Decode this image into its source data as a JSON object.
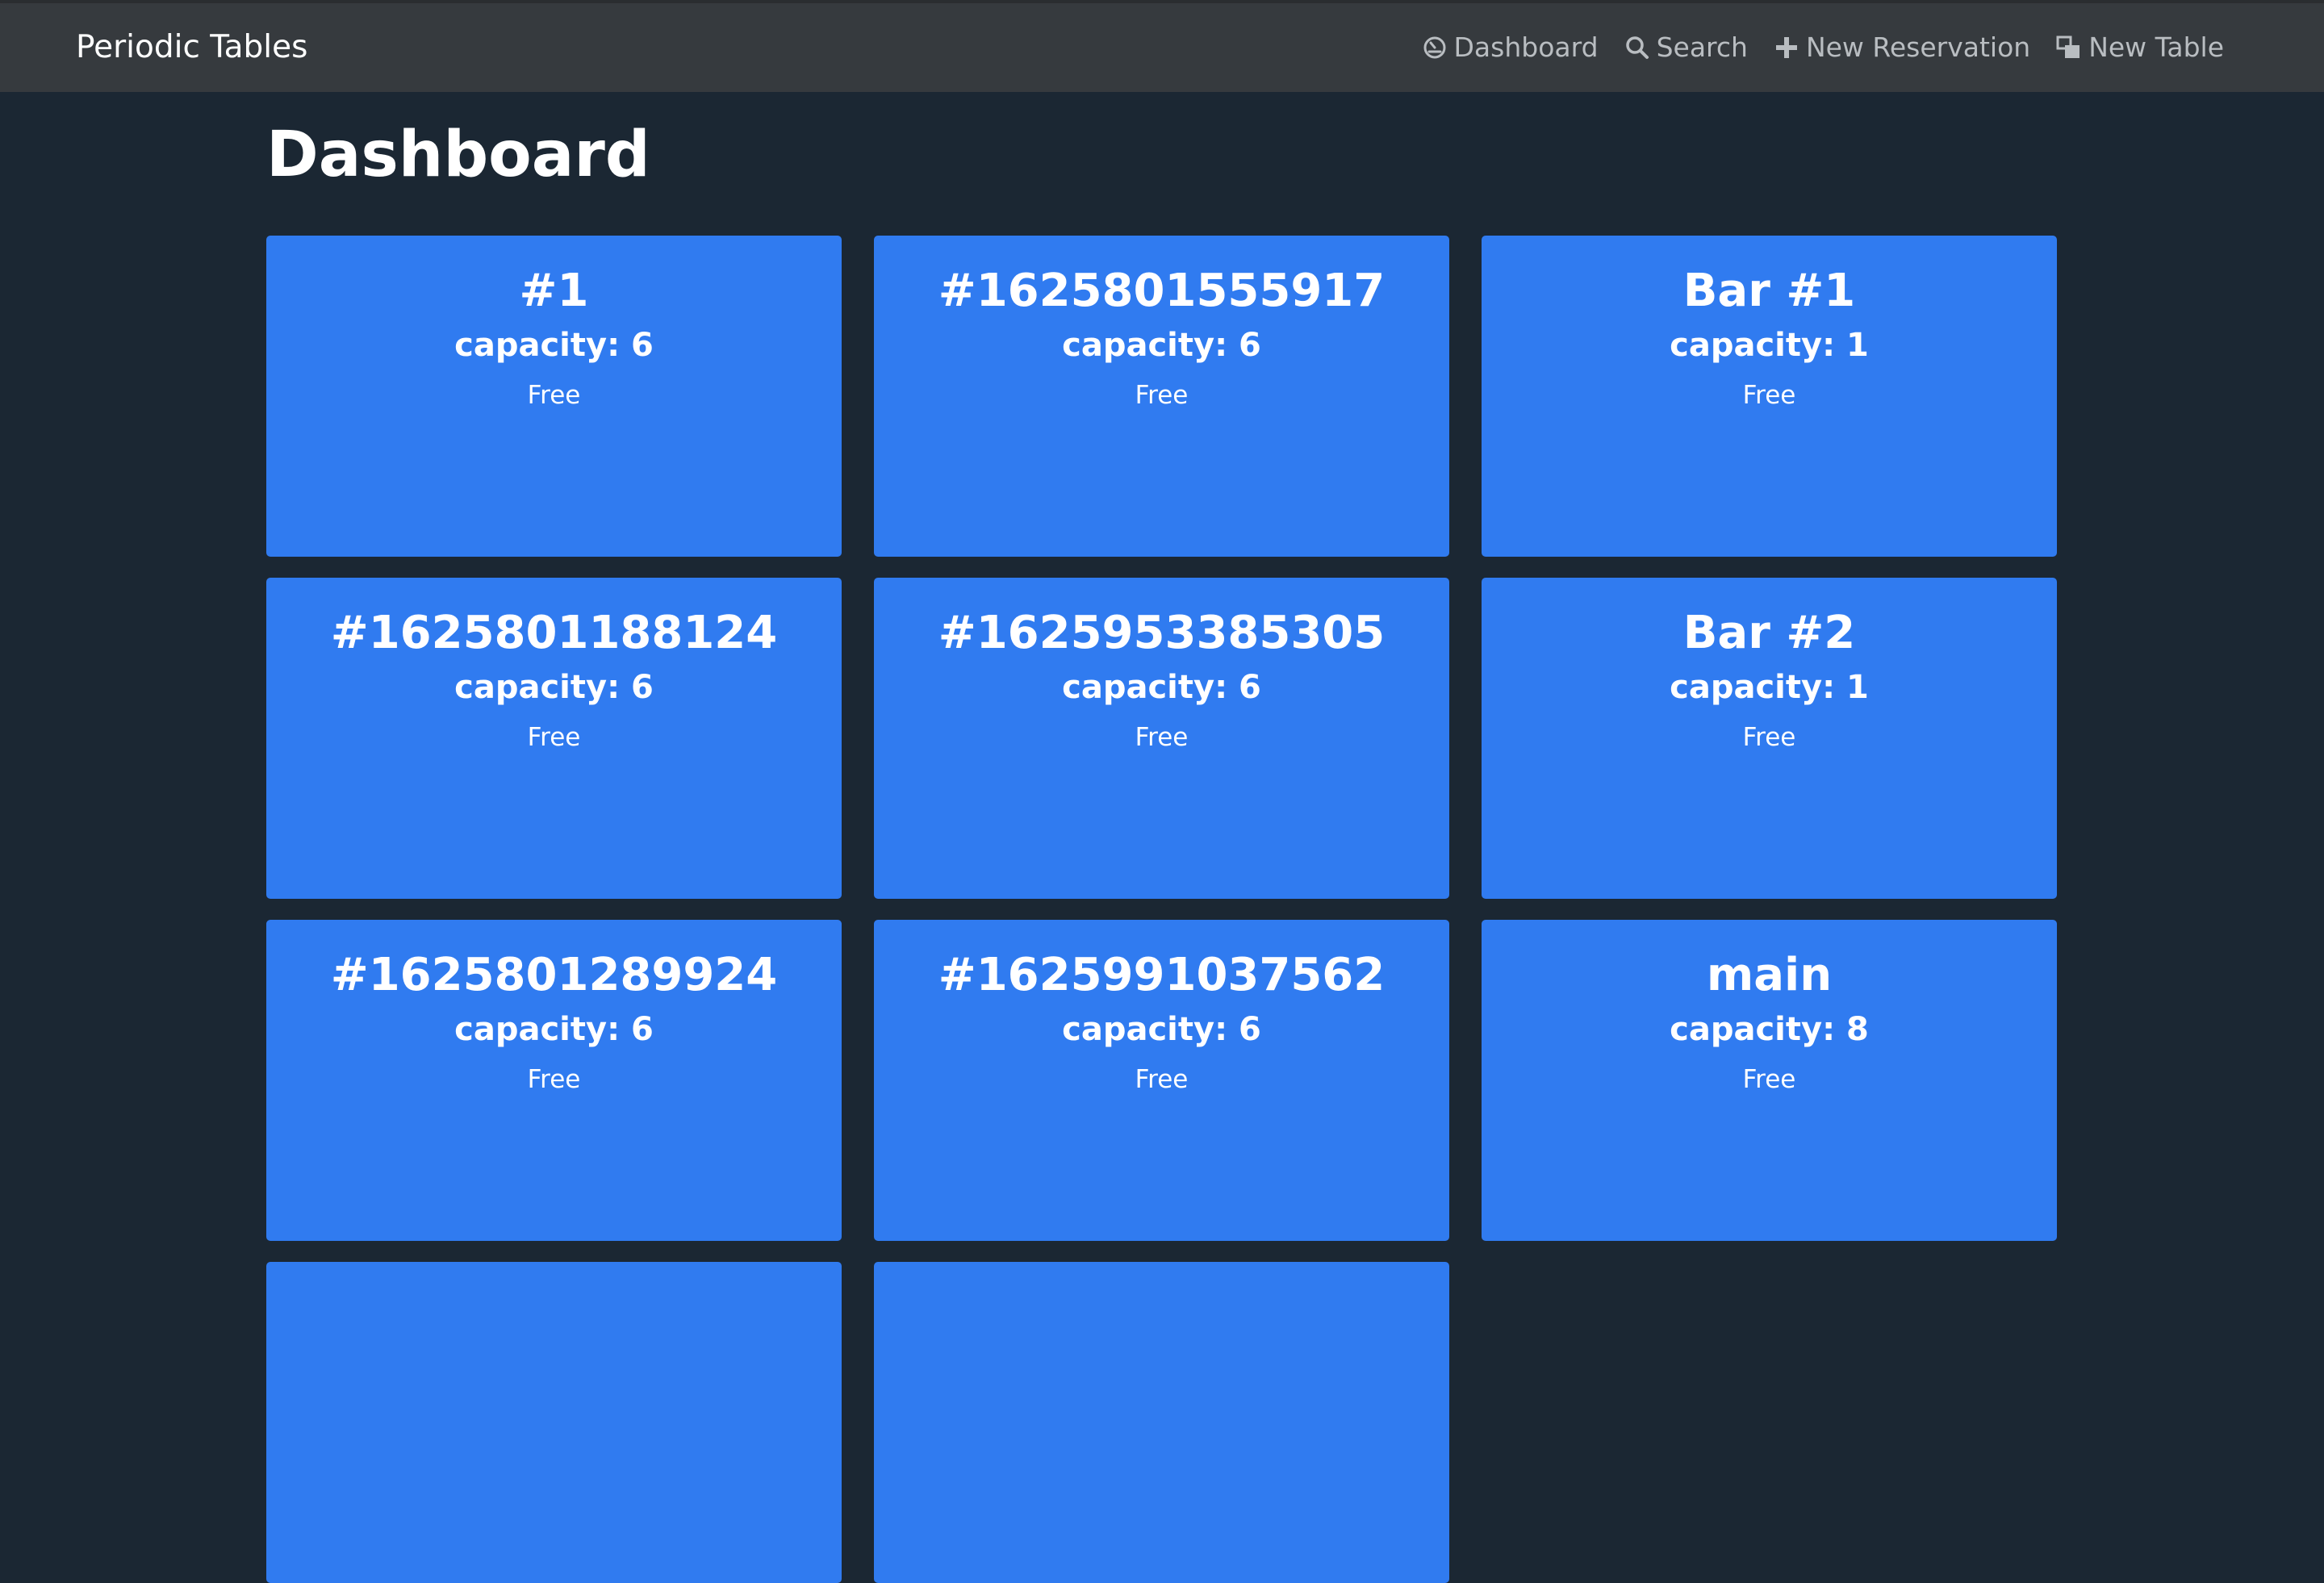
{
  "navbar": {
    "brand": "Periodic Tables",
    "links": [
      {
        "label": "Dashboard",
        "icon": "dashboard-icon"
      },
      {
        "label": "Search",
        "icon": "search-icon"
      },
      {
        "label": "New Reservation",
        "icon": "plus-icon"
      },
      {
        "label": "New Table",
        "icon": "layers-icon"
      }
    ]
  },
  "page": {
    "title": "Dashboard"
  },
  "tables": [
    {
      "name": "#1",
      "capacity": "capacity: 6",
      "status": "Free"
    },
    {
      "name": "#1625801555917",
      "capacity": "capacity: 6",
      "status": "Free"
    },
    {
      "name": "Bar #1",
      "capacity": "capacity: 1",
      "status": "Free"
    },
    {
      "name": "#1625801188124",
      "capacity": "capacity: 6",
      "status": "Free"
    },
    {
      "name": "#1625953385305",
      "capacity": "capacity: 6",
      "status": "Free"
    },
    {
      "name": "Bar #2",
      "capacity": "capacity: 1",
      "status": "Free"
    },
    {
      "name": "#1625801289924",
      "capacity": "capacity: 6",
      "status": "Free"
    },
    {
      "name": "#1625991037562",
      "capacity": "capacity: 6",
      "status": "Free"
    },
    {
      "name": "main",
      "capacity": "capacity: 8",
      "status": "Free"
    },
    {
      "name": "",
      "capacity": "",
      "status": ""
    },
    {
      "name": "",
      "capacity": "",
      "status": ""
    }
  ],
  "colors": {
    "background": "#1b2733",
    "navbar": "#363a3e",
    "card": "#307bf0",
    "nav_text": "#b9bdc1"
  }
}
